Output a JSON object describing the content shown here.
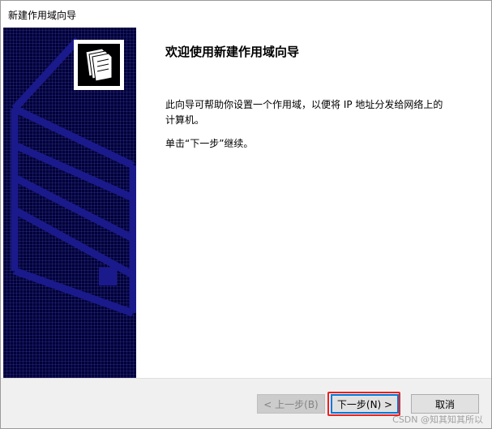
{
  "window": {
    "title": "新建作用域向导"
  },
  "content": {
    "heading": "欢迎使用新建作用域向导",
    "description": "此向导可帮助你设置一个作用域，以便将 IP 地址分发给网络上的计算机。",
    "instruction": "单击“下一步”继续。"
  },
  "buttons": {
    "back_label": "< 上一步(B)",
    "next_label": "下一步(N) >",
    "cancel_label": "取消"
  },
  "watermark": "CSDN @知其知其所以",
  "icons": {
    "wizard": "folder-stack-icon"
  },
  "colors": {
    "banner": "#000038",
    "banner_stripes": "#1a1a8c",
    "highlight": "#e8221f",
    "focus_border": "#0078d7"
  }
}
